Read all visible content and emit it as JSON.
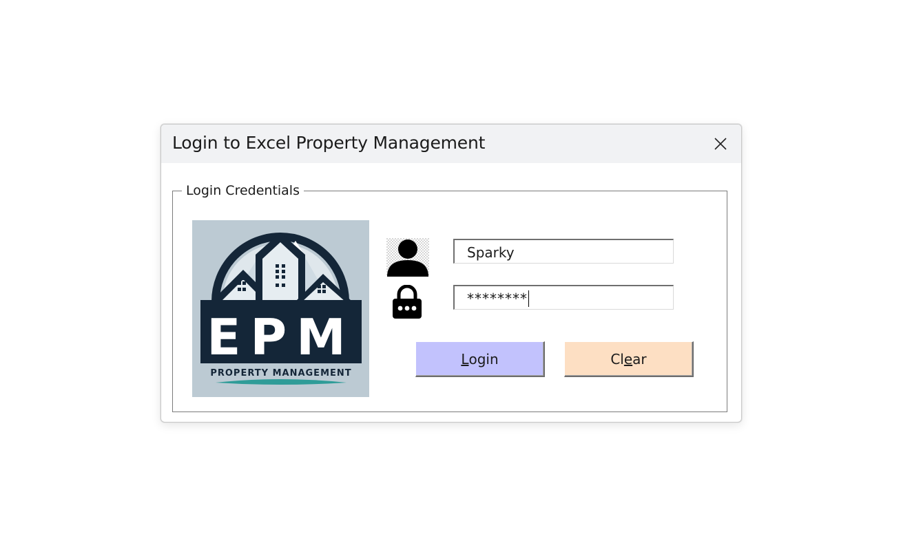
{
  "dialog": {
    "title": "Login to Excel Property Management",
    "close_glyph": "✕"
  },
  "credentials": {
    "legend": "Login Credentials",
    "username_value": "Sparky",
    "password_value": "********"
  },
  "logo": {
    "main_text": "EPM",
    "sub_text": "PROPERTY MANAGEMENT"
  },
  "buttons": {
    "login": {
      "prefix": "",
      "accel": "L",
      "suffix": "ogin",
      "color": "#c2c2fd"
    },
    "clear": {
      "prefix": "Cl",
      "accel": "e",
      "suffix": "ar",
      "color": "#fddfc3"
    }
  },
  "icons": {
    "user": "user-icon",
    "lock": "lock-icon",
    "close": "close-icon"
  },
  "colors": {
    "titlebar": "#f1f2f4",
    "logo_bg": "#bccad3",
    "logo_navy": "#142638",
    "logo_teal": "#2f9c98"
  }
}
